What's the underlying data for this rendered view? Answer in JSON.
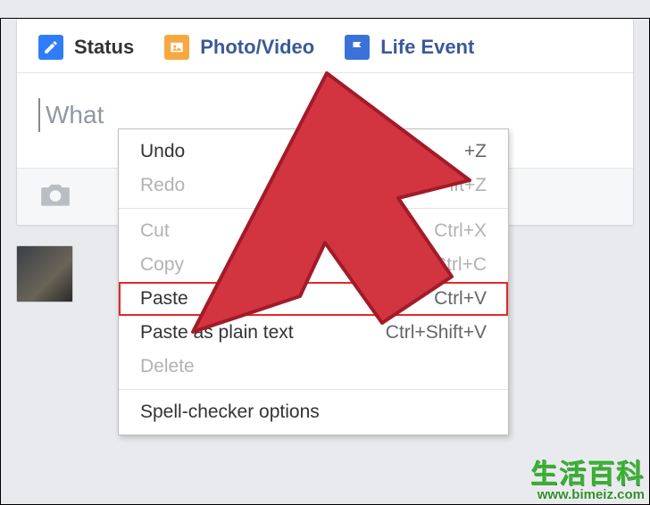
{
  "composer": {
    "tabs": {
      "status": "Status",
      "photo": "Photo/Video",
      "life": "Life Event"
    },
    "placeholder": "What"
  },
  "context_menu": {
    "undo": {
      "label": "Undo",
      "shortcut_suffix": "+Z"
    },
    "redo": {
      "label": "Redo",
      "shortcut_suffix": "ift+Z"
    },
    "cut": {
      "label": "Cut",
      "shortcut": "Ctrl+X"
    },
    "copy": {
      "label": "Copy",
      "shortcut": "Ctrl+C"
    },
    "paste": {
      "label": "Paste",
      "shortcut": "Ctrl+V"
    },
    "paste_plain": {
      "label": "Paste as plain text",
      "shortcut": "Ctrl+Shift+V"
    },
    "delete": {
      "label": "Delete"
    },
    "spellcheck": {
      "label": "Spell-checker options"
    }
  },
  "watermark": {
    "chinese": "生活百科",
    "url": "www.bimeiz.com"
  },
  "colors": {
    "arrow_fill": "#d23440",
    "arrow_stroke": "#a11b28",
    "highlight": "#e62828",
    "fb_blue": "#3b5998"
  }
}
